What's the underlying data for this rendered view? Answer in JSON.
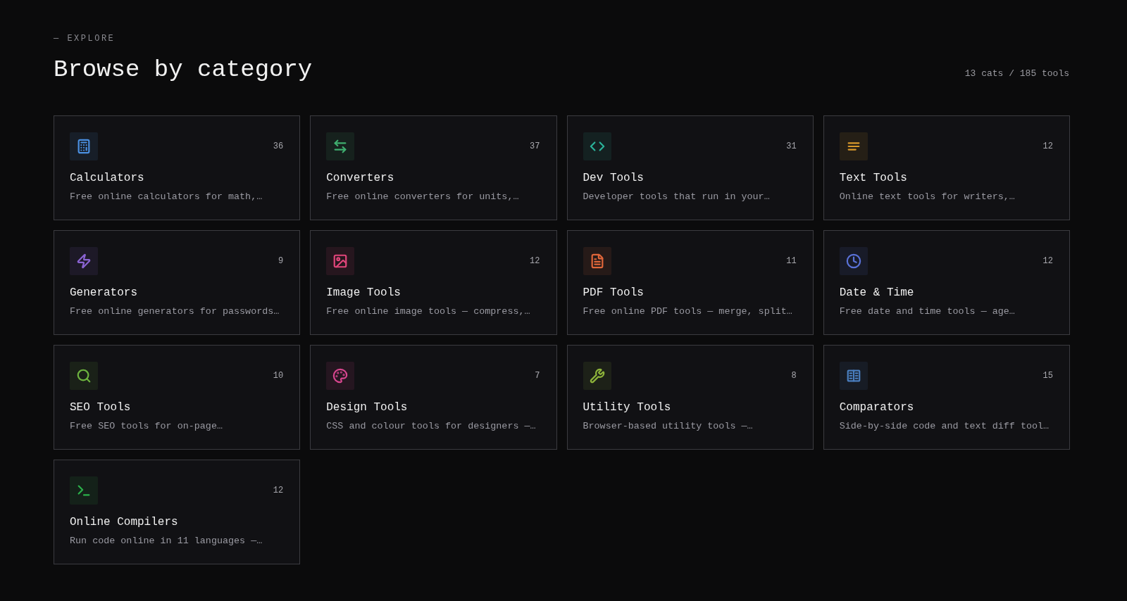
{
  "header": {
    "eyebrow": "— EXPLORE",
    "title": "Browse by category",
    "summary": "13 cats / 185 tools"
  },
  "categories": [
    {
      "name": "Calculators",
      "count": "36",
      "description": "Free online calculators for math,…",
      "color": "#4a8fe0"
    },
    {
      "name": "Converters",
      "count": "37",
      "description": "Free online converters for units,…",
      "color": "#3fae6f"
    },
    {
      "name": "Dev Tools",
      "count": "31",
      "description": "Developer tools that run in your…",
      "color": "#2bb39a"
    },
    {
      "name": "Text Tools",
      "count": "12",
      "description": "Online text tools for writers,…",
      "color": "#d99a2b"
    },
    {
      "name": "Generators",
      "count": "9",
      "description": "Free online generators for passwords…",
      "color": "#8a63d2"
    },
    {
      "name": "Image Tools",
      "count": "12",
      "description": "Free online image tools — compress,…",
      "color": "#e0457a"
    },
    {
      "name": "PDF Tools",
      "count": "11",
      "description": "Free online PDF tools — merge, split…",
      "color": "#e0663a"
    },
    {
      "name": "Date & Time",
      "count": "12",
      "description": "Free date and time tools — age…",
      "color": "#5a72d8"
    },
    {
      "name": "SEO Tools",
      "count": "10",
      "description": "Free SEO tools for on-page…",
      "color": "#6db33f"
    },
    {
      "name": "Design Tools",
      "count": "7",
      "description": "CSS and colour tools for designers —…",
      "color": "#d8468f"
    },
    {
      "name": "Utility Tools",
      "count": "8",
      "description": "Browser-based utility tools —…",
      "color": "#8db33a"
    },
    {
      "name": "Comparators",
      "count": "15",
      "description": "Side-by-side code and text diff tool…",
      "color": "#4a7fc0"
    },
    {
      "name": "Online Compilers",
      "count": "12",
      "description": "Run code online in 11 languages —…",
      "color": "#2bb04a"
    }
  ]
}
